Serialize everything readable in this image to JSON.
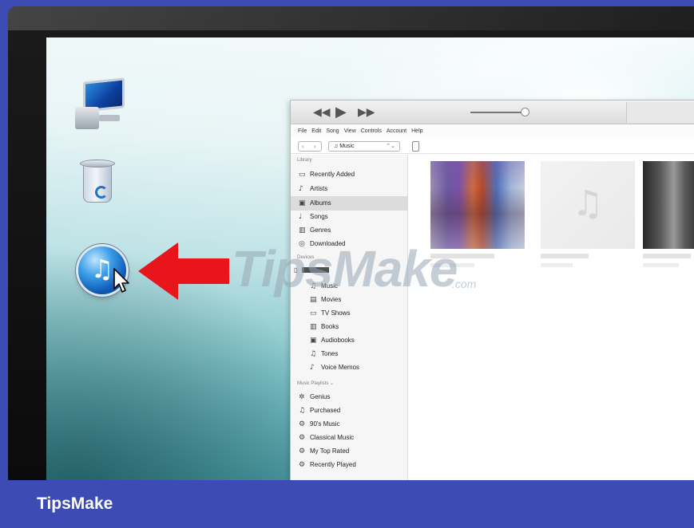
{
  "itunes": {
    "transport": {
      "prev": "◀◀",
      "play": "▶",
      "next": "▶▶"
    },
    "menubar": [
      "File",
      "Edit",
      "Song",
      "View",
      "Controls",
      "Account",
      "Help"
    ],
    "toolbar": {
      "nav": "‹ ›",
      "media_kind": "Music",
      "media_chevron": "⌃⌄"
    },
    "sidebar": {
      "library_header": "Library",
      "library_items": [
        {
          "label": "Recently Added",
          "icon": "calendar-icon"
        },
        {
          "label": "Artists",
          "icon": "microphone-icon"
        },
        {
          "label": "Albums",
          "icon": "album-icon"
        },
        {
          "label": "Songs",
          "icon": "note-icon"
        },
        {
          "label": "Genres",
          "icon": "genres-icon"
        },
        {
          "label": "Downloaded",
          "icon": "download-icon"
        }
      ],
      "devices_header": "Devices",
      "device_items": [
        {
          "label": "Music",
          "icon": "note-icon"
        },
        {
          "label": "Movies",
          "icon": "film-icon"
        },
        {
          "label": "TV Shows",
          "icon": "tv-icon"
        },
        {
          "label": "Books",
          "icon": "book-icon"
        },
        {
          "label": "Audiobooks",
          "icon": "audiobook-icon"
        },
        {
          "label": "Tones",
          "icon": "bell-icon"
        },
        {
          "label": "Voice Memos",
          "icon": "voice-memo-icon"
        }
      ],
      "playlists_header": "Music Playlists ⌄",
      "playlist_items": [
        {
          "label": "Genius",
          "icon": "genius-icon"
        },
        {
          "label": "Purchased",
          "icon": "purchased-icon"
        },
        {
          "label": "90's Music",
          "icon": "smart-playlist-icon"
        },
        {
          "label": "Classical Music",
          "icon": "smart-playlist-icon"
        },
        {
          "label": "My Top Rated",
          "icon": "smart-playlist-icon"
        },
        {
          "label": "Recently Played",
          "icon": "smart-playlist-icon"
        }
      ]
    }
  },
  "watermark": {
    "text": "TipsMake",
    "tld": ".com"
  },
  "footer": {
    "brand": "TipsMake"
  },
  "colors": {
    "footer_bg": "#3d4bb5",
    "arrow": "#e8151b",
    "itunes_blue": "#1f76c9"
  }
}
